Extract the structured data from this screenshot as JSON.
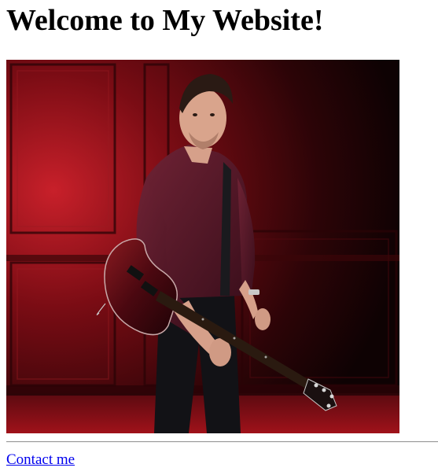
{
  "page": {
    "heading": "Welcome to My Website!",
    "contact_link": "Contact me"
  },
  "photo": {
    "subject": "man-with-electric-guitar",
    "colors": {
      "wall": "#7a0c14",
      "shirt": "#5a1a2a",
      "guitar": "#4a0a10"
    }
  }
}
